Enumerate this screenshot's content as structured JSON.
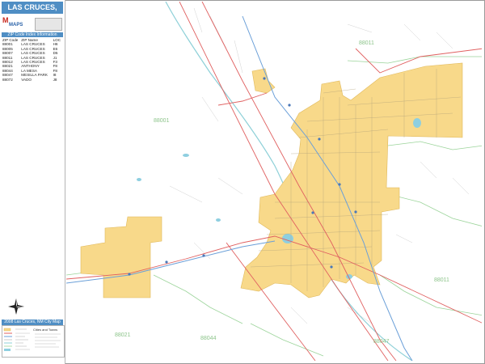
{
  "title": "LAS CRUCES, NM",
  "zip_table_header": "ZIP Code Index Information",
  "zip_table": {
    "columns": [
      "ZIP Code",
      "ZIP Name",
      "LOC"
    ],
    "rows": [
      [
        "88001",
        "LAS CRUCES",
        "H6"
      ],
      [
        "88005",
        "LAS CRUCES",
        "E6"
      ],
      [
        "88007",
        "LAS CRUCES",
        "D5"
      ],
      [
        "88011",
        "LAS CRUCES",
        "J1"
      ],
      [
        "88012",
        "LAS CRUCES",
        "F3"
      ],
      [
        "88021",
        "ANTHONY",
        "F8"
      ],
      [
        "88044",
        "LA MESA",
        "F8"
      ],
      [
        "88047",
        "MESILLA PARK",
        "I8"
      ],
      [
        "88072",
        "VADO",
        "J8"
      ]
    ]
  },
  "legend_header": "2008 Las Cruces, NM City Map",
  "legend_subtitle": "Cities and Towns",
  "map": {
    "zip_labels": [
      "88011",
      "88001",
      "88011",
      "88021",
      "88044",
      "88047"
    ],
    "colors": {
      "city": "#f8d98a",
      "city_border": "#e0b85a",
      "highway": "#e06060",
      "interstate": "#6a9fd8",
      "river": "#8ed0d8",
      "zip_boundary": "#9bd49a",
      "street": "#a8a8a8",
      "water": "#8ecfe0"
    }
  },
  "icons": [
    "compass-icon",
    "logo-icon"
  ]
}
